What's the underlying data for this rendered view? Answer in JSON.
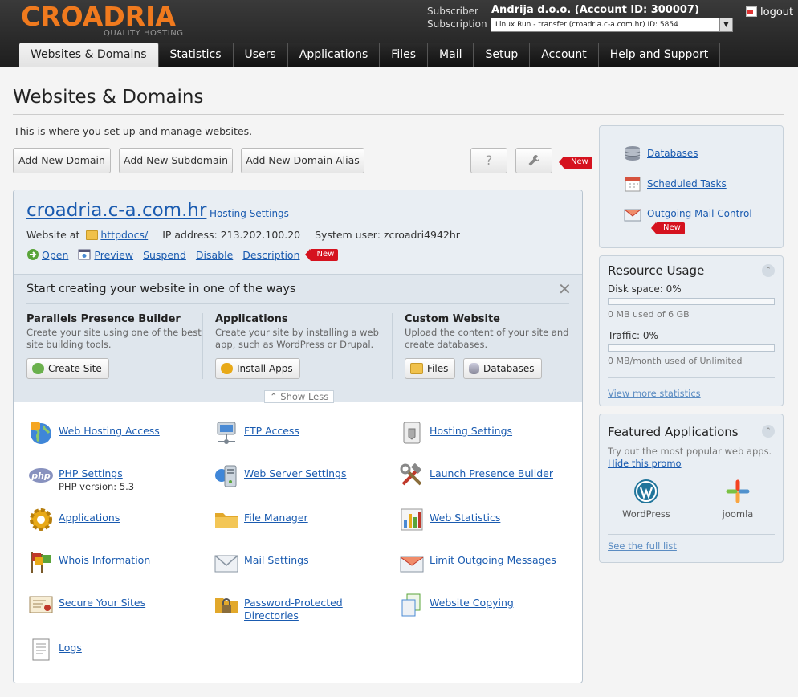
{
  "header": {
    "logo_text": "CROADRIA",
    "logo_sub": "QUALITY HOSTING",
    "subscriber_label": "Subscriber",
    "subscription_label": "Subscription",
    "subscriber_name": "Andrija d.o.o. (Account ID: 300007)",
    "subscription_value": "Linux Run - transfer (croadria.c-a.com.hr) ID: 5854",
    "logout": "logout"
  },
  "nav": {
    "tabs": [
      "Websites & Domains",
      "Statistics",
      "Users",
      "Applications",
      "Files",
      "Mail",
      "Setup",
      "Account",
      "Help and Support"
    ],
    "active": "Websites & Domains"
  },
  "page": {
    "title": "Websites & Domains",
    "intro": "This is where you set up and manage websites.",
    "buttons": {
      "add_domain": "Add New Domain",
      "add_subdomain": "Add New Subdomain",
      "add_alias": "Add New Domain Alias",
      "help": "?",
      "new_badge": "New"
    }
  },
  "domain": {
    "name": "croadria.c-a.com.hr",
    "hosting_settings": "Hosting Settings",
    "website_at_label": "Website at",
    "website_at_folder": "httpdocs/",
    "ip_label": "IP address:",
    "ip": "213.202.100.20",
    "sysuser_label": "System user:",
    "sysuser": "zcroadri4942hr",
    "links": {
      "open": "Open",
      "preview": "Preview",
      "suspend": "Suspend",
      "disable": "Disable",
      "description": "Description",
      "new": "New"
    }
  },
  "start": {
    "title": "Start creating your website in one of the ways",
    "close": "✕",
    "columns": [
      {
        "title": "Parallels Presence Builder",
        "desc": "Create your site using one of the best site building tools.",
        "button": "Create Site"
      },
      {
        "title": "Applications",
        "desc": "Create your site by installing a web app, such as WordPress or Drupal.",
        "button": "Install Apps"
      },
      {
        "title": "Custom Website",
        "desc": "Upload the content of your site and create databases.",
        "buttons": [
          "Files",
          "Databases"
        ]
      }
    ],
    "show_less": "Show Less"
  },
  "tools": {
    "web_hosting_access": "Web Hosting Access",
    "ftp_access": "FTP Access",
    "hosting_settings": "Hosting Settings",
    "php_settings": "PHP Settings",
    "php_version": "PHP version: 5.3",
    "web_server_settings": "Web Server Settings",
    "launch_presence_builder": "Launch Presence Builder",
    "applications": "Applications",
    "file_manager": "File Manager",
    "web_statistics": "Web Statistics",
    "whois_information": "Whois Information",
    "mail_settings": "Mail Settings",
    "limit_outgoing_messages": "Limit Outgoing Messages",
    "secure_your_sites": "Secure Your Sites",
    "password_protected_1": "Password-Protected",
    "password_protected_2": "Directories",
    "website_copying": "Website Copying",
    "logs": "Logs",
    "php_icon_text": "php"
  },
  "side_links": {
    "databases": "Databases",
    "scheduled_tasks": "Scheduled Tasks",
    "outgoing_mail_control": "Outgoing Mail Control",
    "new": "New"
  },
  "resource_usage": {
    "title": "Resource Usage",
    "disk_label": "Disk space: 0%",
    "disk_detail": "0 MB used of 6 GB",
    "disk_fraction": 0,
    "traffic_label": "Traffic: 0%",
    "traffic_detail": "0 MB/month used of Unlimited",
    "traffic_fraction": 0,
    "more_stats": "View more statistics",
    "collapse": "⌃"
  },
  "featured": {
    "title": "Featured Applications",
    "desc": "Try out the most popular web apps.",
    "hide_promo": "Hide this promo",
    "apps": [
      "WordPress",
      "joomla"
    ],
    "full_list": "See the full list",
    "collapse": "⌃"
  }
}
